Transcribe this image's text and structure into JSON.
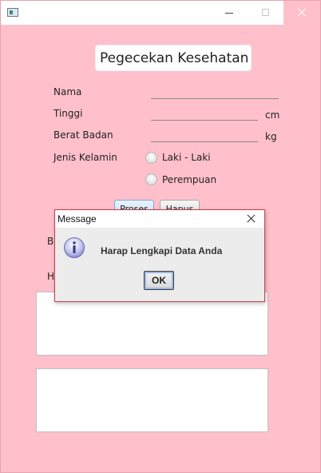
{
  "window": {
    "title": "",
    "title_icon": "java-app-icon",
    "controls": [
      "minimize-icon",
      "maximize-icon",
      "close-icon"
    ],
    "colors": {
      "background": "#ffc0cb",
      "close_hover": "#ffc0cb"
    }
  },
  "form": {
    "heading": "Pegecekan Kesehatan",
    "fields": {
      "nama_label": "Nama",
      "tinggi_label": "Tinggi",
      "tinggi_unit": "cm",
      "berat_label": "Berat Badan",
      "berat_unit": "kg",
      "gender_label": "Jenis Kelamin"
    },
    "gender_options": [
      "Laki - Laki",
      "Perempuan"
    ],
    "buttons": {
      "process": "Proses",
      "clear": "Hapus"
    },
    "partial_labels": {
      "be": "Be",
      "h": "H"
    }
  },
  "dialog": {
    "title": "Message",
    "icon": "info-icon",
    "message": "Harap Lengkapi Data Anda",
    "ok_label": "OK"
  }
}
